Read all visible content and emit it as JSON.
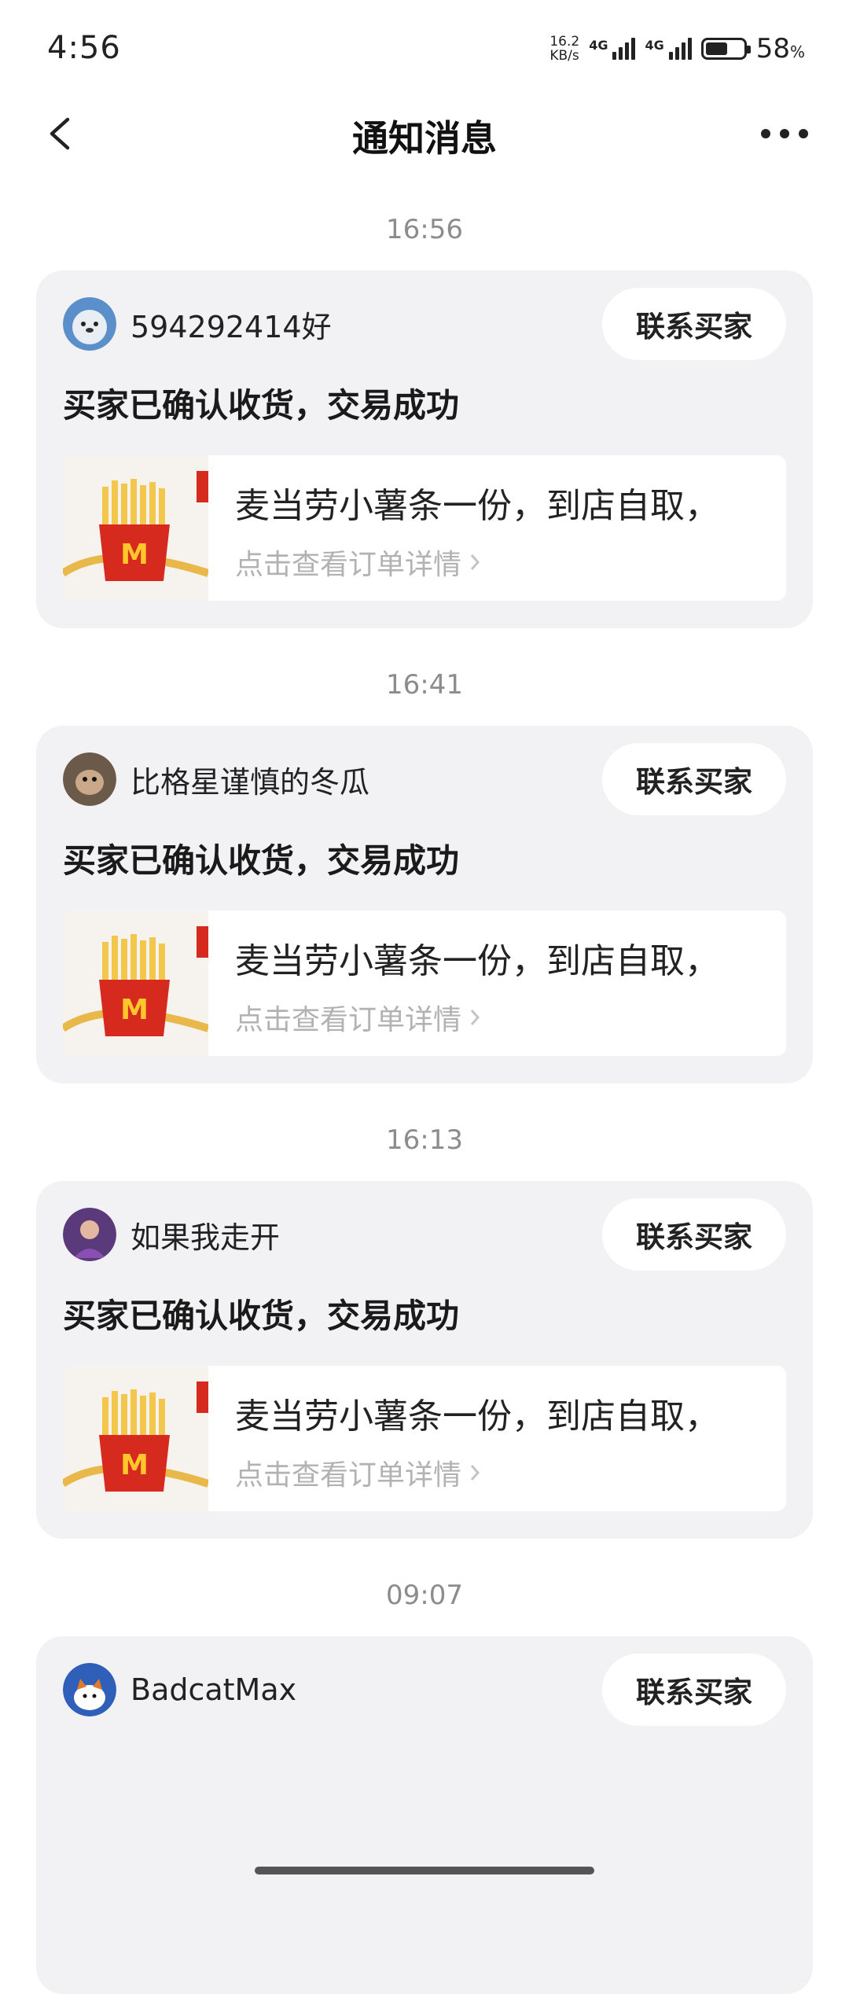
{
  "status_bar": {
    "time": "4:56",
    "net_speed_value": "16.2",
    "net_speed_unit": "KB/s",
    "sim1": "4G",
    "sim2": "4G",
    "battery_percent": "58",
    "battery_unit": "%",
    "battery_level": 0.58
  },
  "header": {
    "title": "通知消息"
  },
  "notifications": [
    {
      "time": "16:56",
      "user": "594292414好",
      "avatar_icon": "seal-avatar",
      "contact_label": "联系买家",
      "status": "买家已确认收货，交易成功",
      "product": "麦当劳小薯条一份，到店自取，",
      "detail_link": "点击查看订单详情"
    },
    {
      "time": "16:41",
      "user": "比格星谨慎的冬瓜",
      "avatar_icon": "dog-avatar",
      "contact_label": "联系买家",
      "status": "买家已确认收货，交易成功",
      "product": "麦当劳小薯条一份，到店自取，",
      "detail_link": "点击查看订单详情"
    },
    {
      "time": "16:13",
      "user": "如果我走开",
      "avatar_icon": "person-avatar",
      "contact_label": "联系买家",
      "status": "买家已确认收货，交易成功",
      "product": "麦当劳小薯条一份，到店自取，",
      "detail_link": "点击查看订单详情"
    },
    {
      "time": "09:07",
      "user": "BadcatMax",
      "avatar_icon": "cat-avatar",
      "contact_label": "联系买家"
    }
  ],
  "colors": {
    "card_bg": "#f2f2f4",
    "muted_text": "#8c8c8c",
    "link_text": "#b2b2b2"
  }
}
